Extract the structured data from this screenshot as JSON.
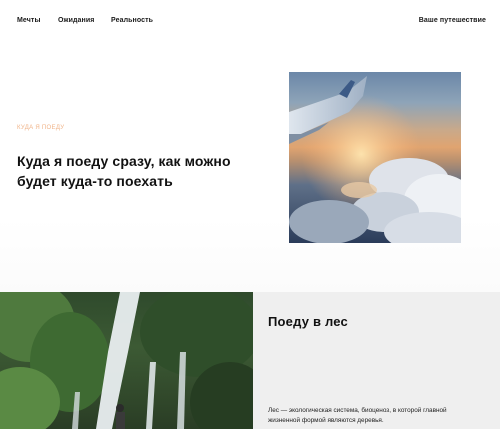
{
  "nav": {
    "items": [
      {
        "label": "Мечты"
      },
      {
        "label": "Ожидания"
      },
      {
        "label": "Реальность"
      }
    ],
    "right_label": "Ваше путешествие"
  },
  "hero": {
    "tag": "КУДА Я ПОЕДУ",
    "title": "Куда я поеду сразу, как можно будет куда-то поехать",
    "image": "airplane-wing-over-clouds"
  },
  "section": {
    "image": "forest-waterfall",
    "title": "Поеду в лес",
    "text": "Лес — экологическая система, биоценоз, в которой главной жизненной формой являются деревья."
  },
  "colors": {
    "accent": "#f0b489",
    "panel_bg": "#efefef",
    "text": "#111111"
  }
}
